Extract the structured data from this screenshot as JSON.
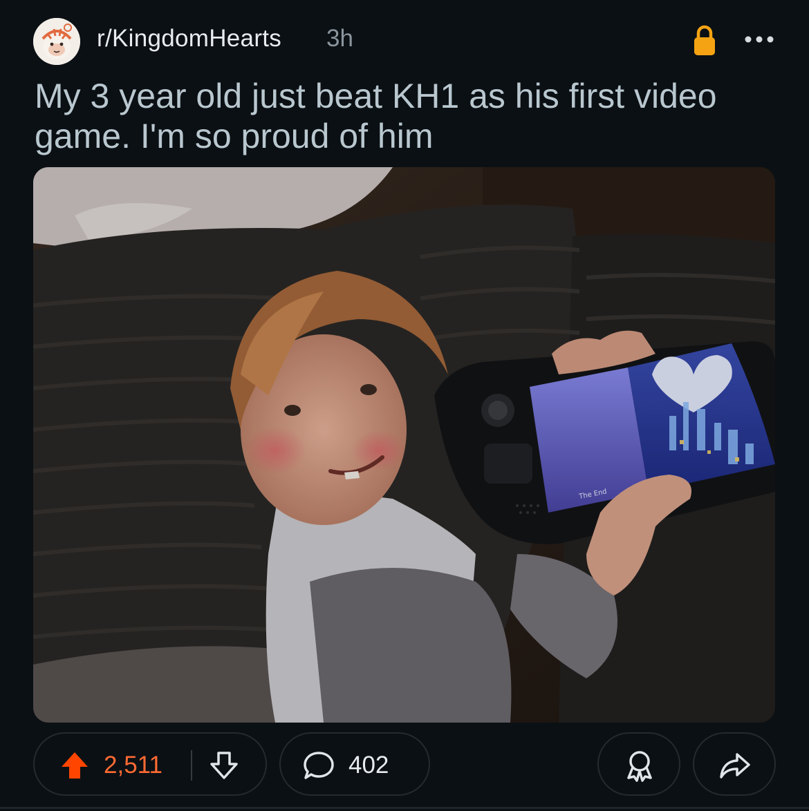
{
  "post": {
    "subreddit": "r/KingdomHearts",
    "age": "3h",
    "title": "My 3 year old just beat KH1 as his first video game. I'm so proud of him",
    "image_alt": "Toddler smiling while holding a Steam Deck showing the Kingdom Hearts ending screen",
    "screen_caption": "The End"
  },
  "actions": {
    "upvotes": "2,511",
    "comments": "402"
  },
  "icons": {
    "avatar": "subreddit-avatar",
    "lock": "lock-icon",
    "more": "more-icon",
    "upvote": "upvote-arrow-icon",
    "downvote": "downvote-arrow-icon",
    "comment": "comment-bubble-icon",
    "award": "award-icon",
    "share": "share-arrow-icon"
  },
  "colors": {
    "background": "#0b1014",
    "upvote_active": "#ff6a33",
    "lock": "#f5a313",
    "title_text": "#b9c7cf",
    "pill_border": "#242b30"
  }
}
